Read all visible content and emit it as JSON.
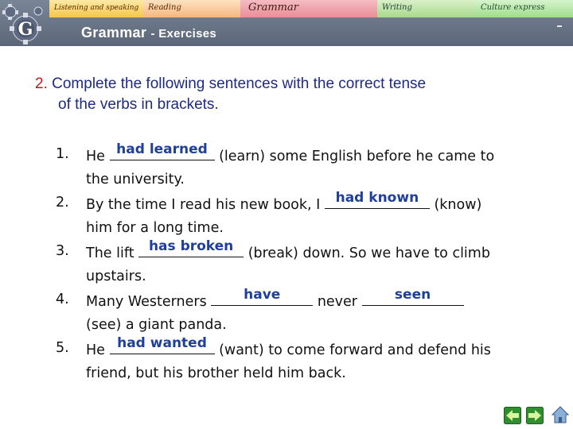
{
  "header": {
    "title": "Grammar",
    "subtitle": "- Exercises",
    "tabs": [
      {
        "label": "Listening and speaking"
      },
      {
        "label": "Reading"
      },
      {
        "label": "Grammar"
      },
      {
        "label": "Writing"
      },
      {
        "label": "Culture express"
      }
    ],
    "logo_letter": "G"
  },
  "task": {
    "number": "2.",
    "line1": "Complete the following sentences with the correct tense",
    "line2": "of the verbs in brackets."
  },
  "sentences": [
    {
      "num": "1.",
      "before": "He ",
      "answer": "had learned",
      "after": " (learn) some English before he came to",
      "line2": "the university."
    },
    {
      "num": "2.",
      "before": "By the time I read his new book, I ",
      "answer": "had known",
      "after": " (know)",
      "line2": "him for a long time."
    },
    {
      "num": "3.",
      "before": "The lift ",
      "answer": "has broken",
      "after": " (break) down. So we have to climb",
      "line2": "upstairs."
    },
    {
      "num": "4.",
      "before": "Many Westerners ",
      "answer": "have",
      "middle": " never ",
      "answer2": "seen",
      "line2": "(see) a giant panda."
    },
    {
      "num": "5.",
      "before": "He ",
      "answer": "had wanted",
      "after": " (want) to come forward and defend his",
      "line2": "friend, but his brother held him back."
    }
  ],
  "nav": {
    "back_icon": "back-arrow-icon",
    "forward_icon": "forward-arrow-icon",
    "home_icon": "home-icon"
  },
  "colors": {
    "header_bg": "#6a7588",
    "task_text": "#1e2a80",
    "task_number": "#c01818",
    "answer_text": "#1f3f99"
  }
}
